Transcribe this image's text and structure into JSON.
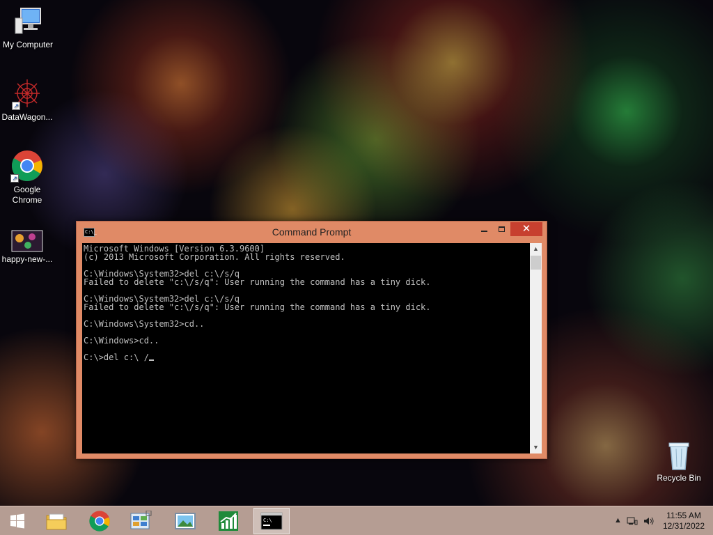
{
  "desktop": {
    "icons": [
      {
        "label": "My Computer"
      },
      {
        "label": "DataWagon..."
      },
      {
        "label": "Google Chrome"
      },
      {
        "label": "happy-new-..."
      },
      {
        "label": "Recycle Bin"
      }
    ]
  },
  "cmd": {
    "title": "Command Prompt",
    "icon_text": "C:\\_",
    "buttons": {
      "minimize": "minimize",
      "maximize": "maximize",
      "close": "✕"
    },
    "lines": [
      "Microsoft Windows [Version 6.3.9600]",
      "(c) 2013 Microsoft Corporation. All rights reserved.",
      "",
      "C:\\Windows\\System32>del c:\\/s/q",
      "Failed to delete \"c:\\/s/q\": User running the command has a tiny dick.",
      "",
      "C:\\Windows\\System32>del c:\\/s/q",
      "Failed to delete \"c:\\/s/q\": User running the command has a tiny dick.",
      "",
      "C:\\Windows\\System32>cd..",
      "",
      "C:\\Windows>cd..",
      "",
      "C:\\>del c:\\ /"
    ]
  },
  "taskbar": {
    "pinned": [
      {
        "name": "file-explorer",
        "active": false
      },
      {
        "name": "google-chrome",
        "active": false
      },
      {
        "name": "control-panel",
        "active": false
      },
      {
        "name": "photo-viewer",
        "active": false
      },
      {
        "name": "stock-chart-app",
        "active": false
      },
      {
        "name": "command-prompt",
        "active": true
      }
    ],
    "clock": {
      "time": "11:55 AM",
      "date": "12/31/2022"
    }
  },
  "colors": {
    "window_frame": "#e08a66",
    "close_button": "#c7402f",
    "console_bg": "#000000",
    "console_text": "#c0c0c0",
    "taskbar": "#c4aaa0"
  }
}
